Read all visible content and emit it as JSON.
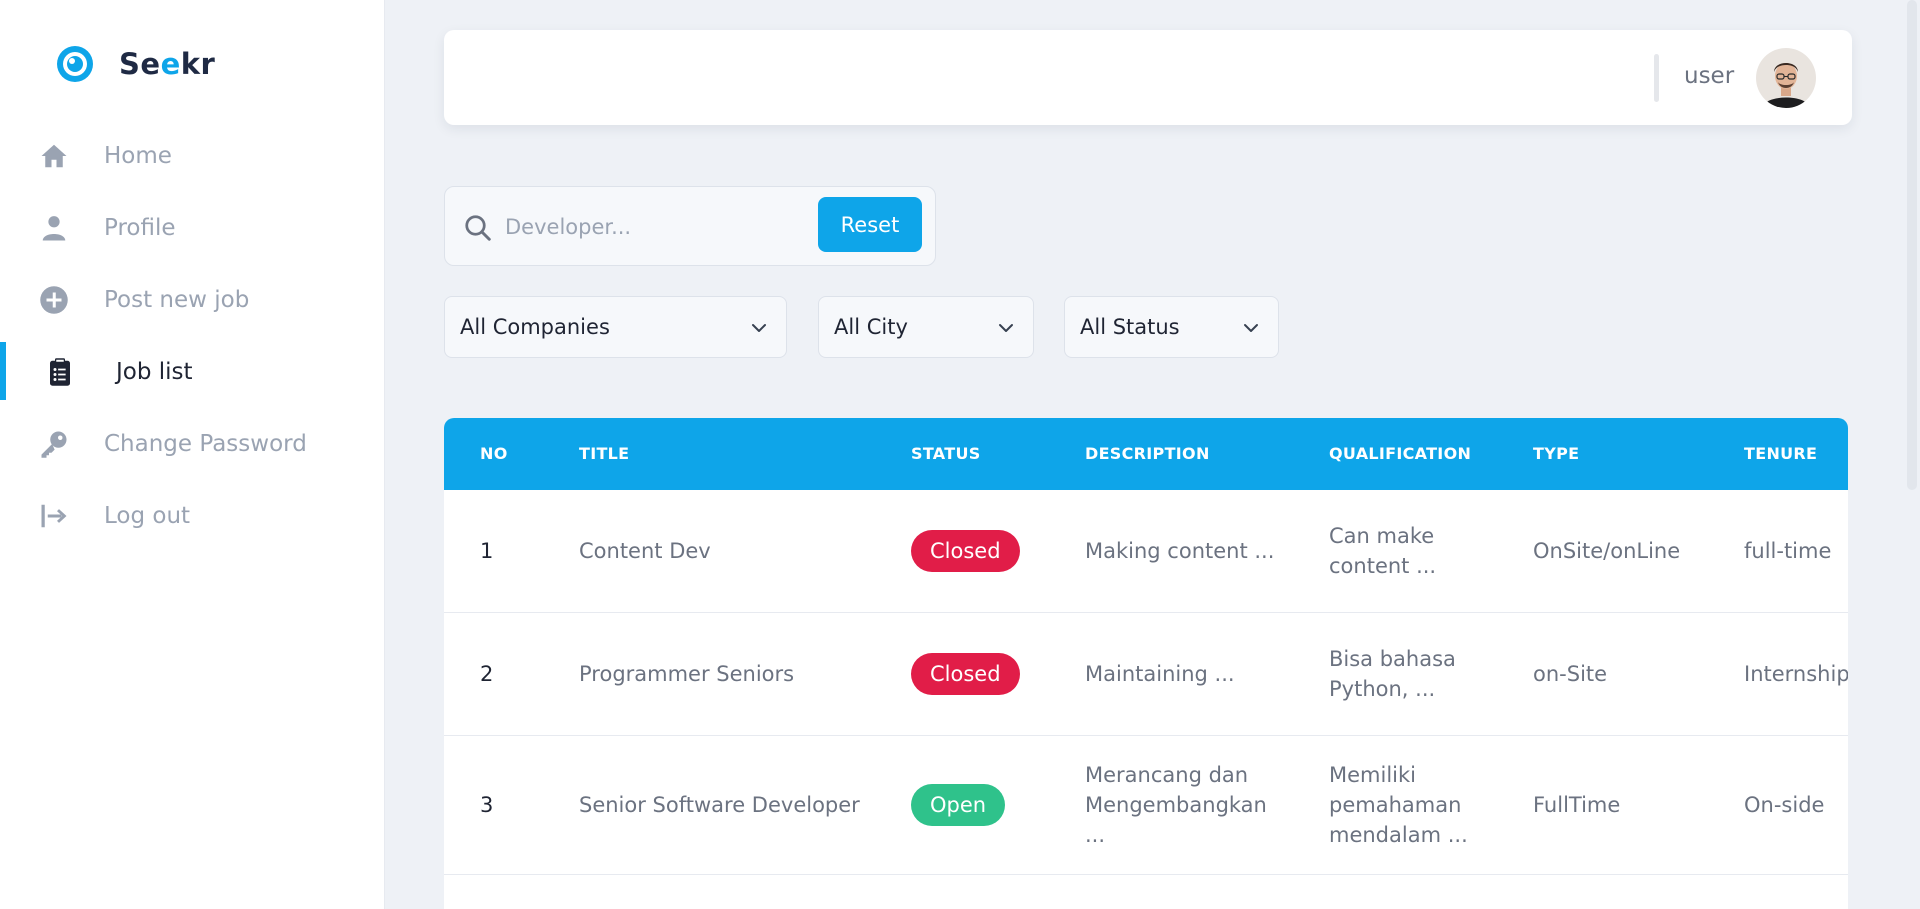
{
  "app": {
    "name_prefix": "Se",
    "name_accent": "e",
    "name_suffix": "kr",
    "accent_color": "#0ea5e9"
  },
  "sidebar": {
    "items": [
      {
        "label": "Home",
        "icon": "home-icon"
      },
      {
        "label": "Profile",
        "icon": "user-icon"
      },
      {
        "label": "Post new job",
        "icon": "plus-circle-icon"
      },
      {
        "label": "Job list",
        "icon": "clipboard-icon",
        "active": true
      },
      {
        "label": "Change Password",
        "icon": "key-icon"
      },
      {
        "label": "Log out",
        "icon": "logout-icon"
      }
    ]
  },
  "header": {
    "username": "user"
  },
  "search": {
    "placeholder": "Developer...",
    "value": "",
    "reset_label": "Reset"
  },
  "filters": {
    "companies": "All Companies",
    "city": "All City",
    "status": "All Status"
  },
  "table": {
    "columns": [
      "NO",
      "TITLE",
      "STATUS",
      "DESCRIPTION",
      "QUALIFICATION",
      "TYPE",
      "TENURE"
    ],
    "rows": [
      {
        "no": "1",
        "title": "Content Dev",
        "status": "Closed",
        "description": "Making content ...",
        "qualification": "Can make content ...",
        "type": "OnSite/onLine",
        "tenure": "full-time"
      },
      {
        "no": "2",
        "title": "Programmer Seniors",
        "status": "Closed",
        "description": "Maintaining ...",
        "qualification": "Bisa bahasa Python, ...",
        "type": "on-Site",
        "tenure": "Internship"
      },
      {
        "no": "3",
        "title": "Senior Software Developer",
        "status": "Open",
        "description": "Merancang dan Mengembangkan ...",
        "qualification": "Memiliki pemahaman mendalam ...",
        "type": "FullTime",
        "tenure": "On-side"
      }
    ],
    "status_colors": {
      "Closed": "#e11d48",
      "Open": "#2fc28b"
    }
  }
}
